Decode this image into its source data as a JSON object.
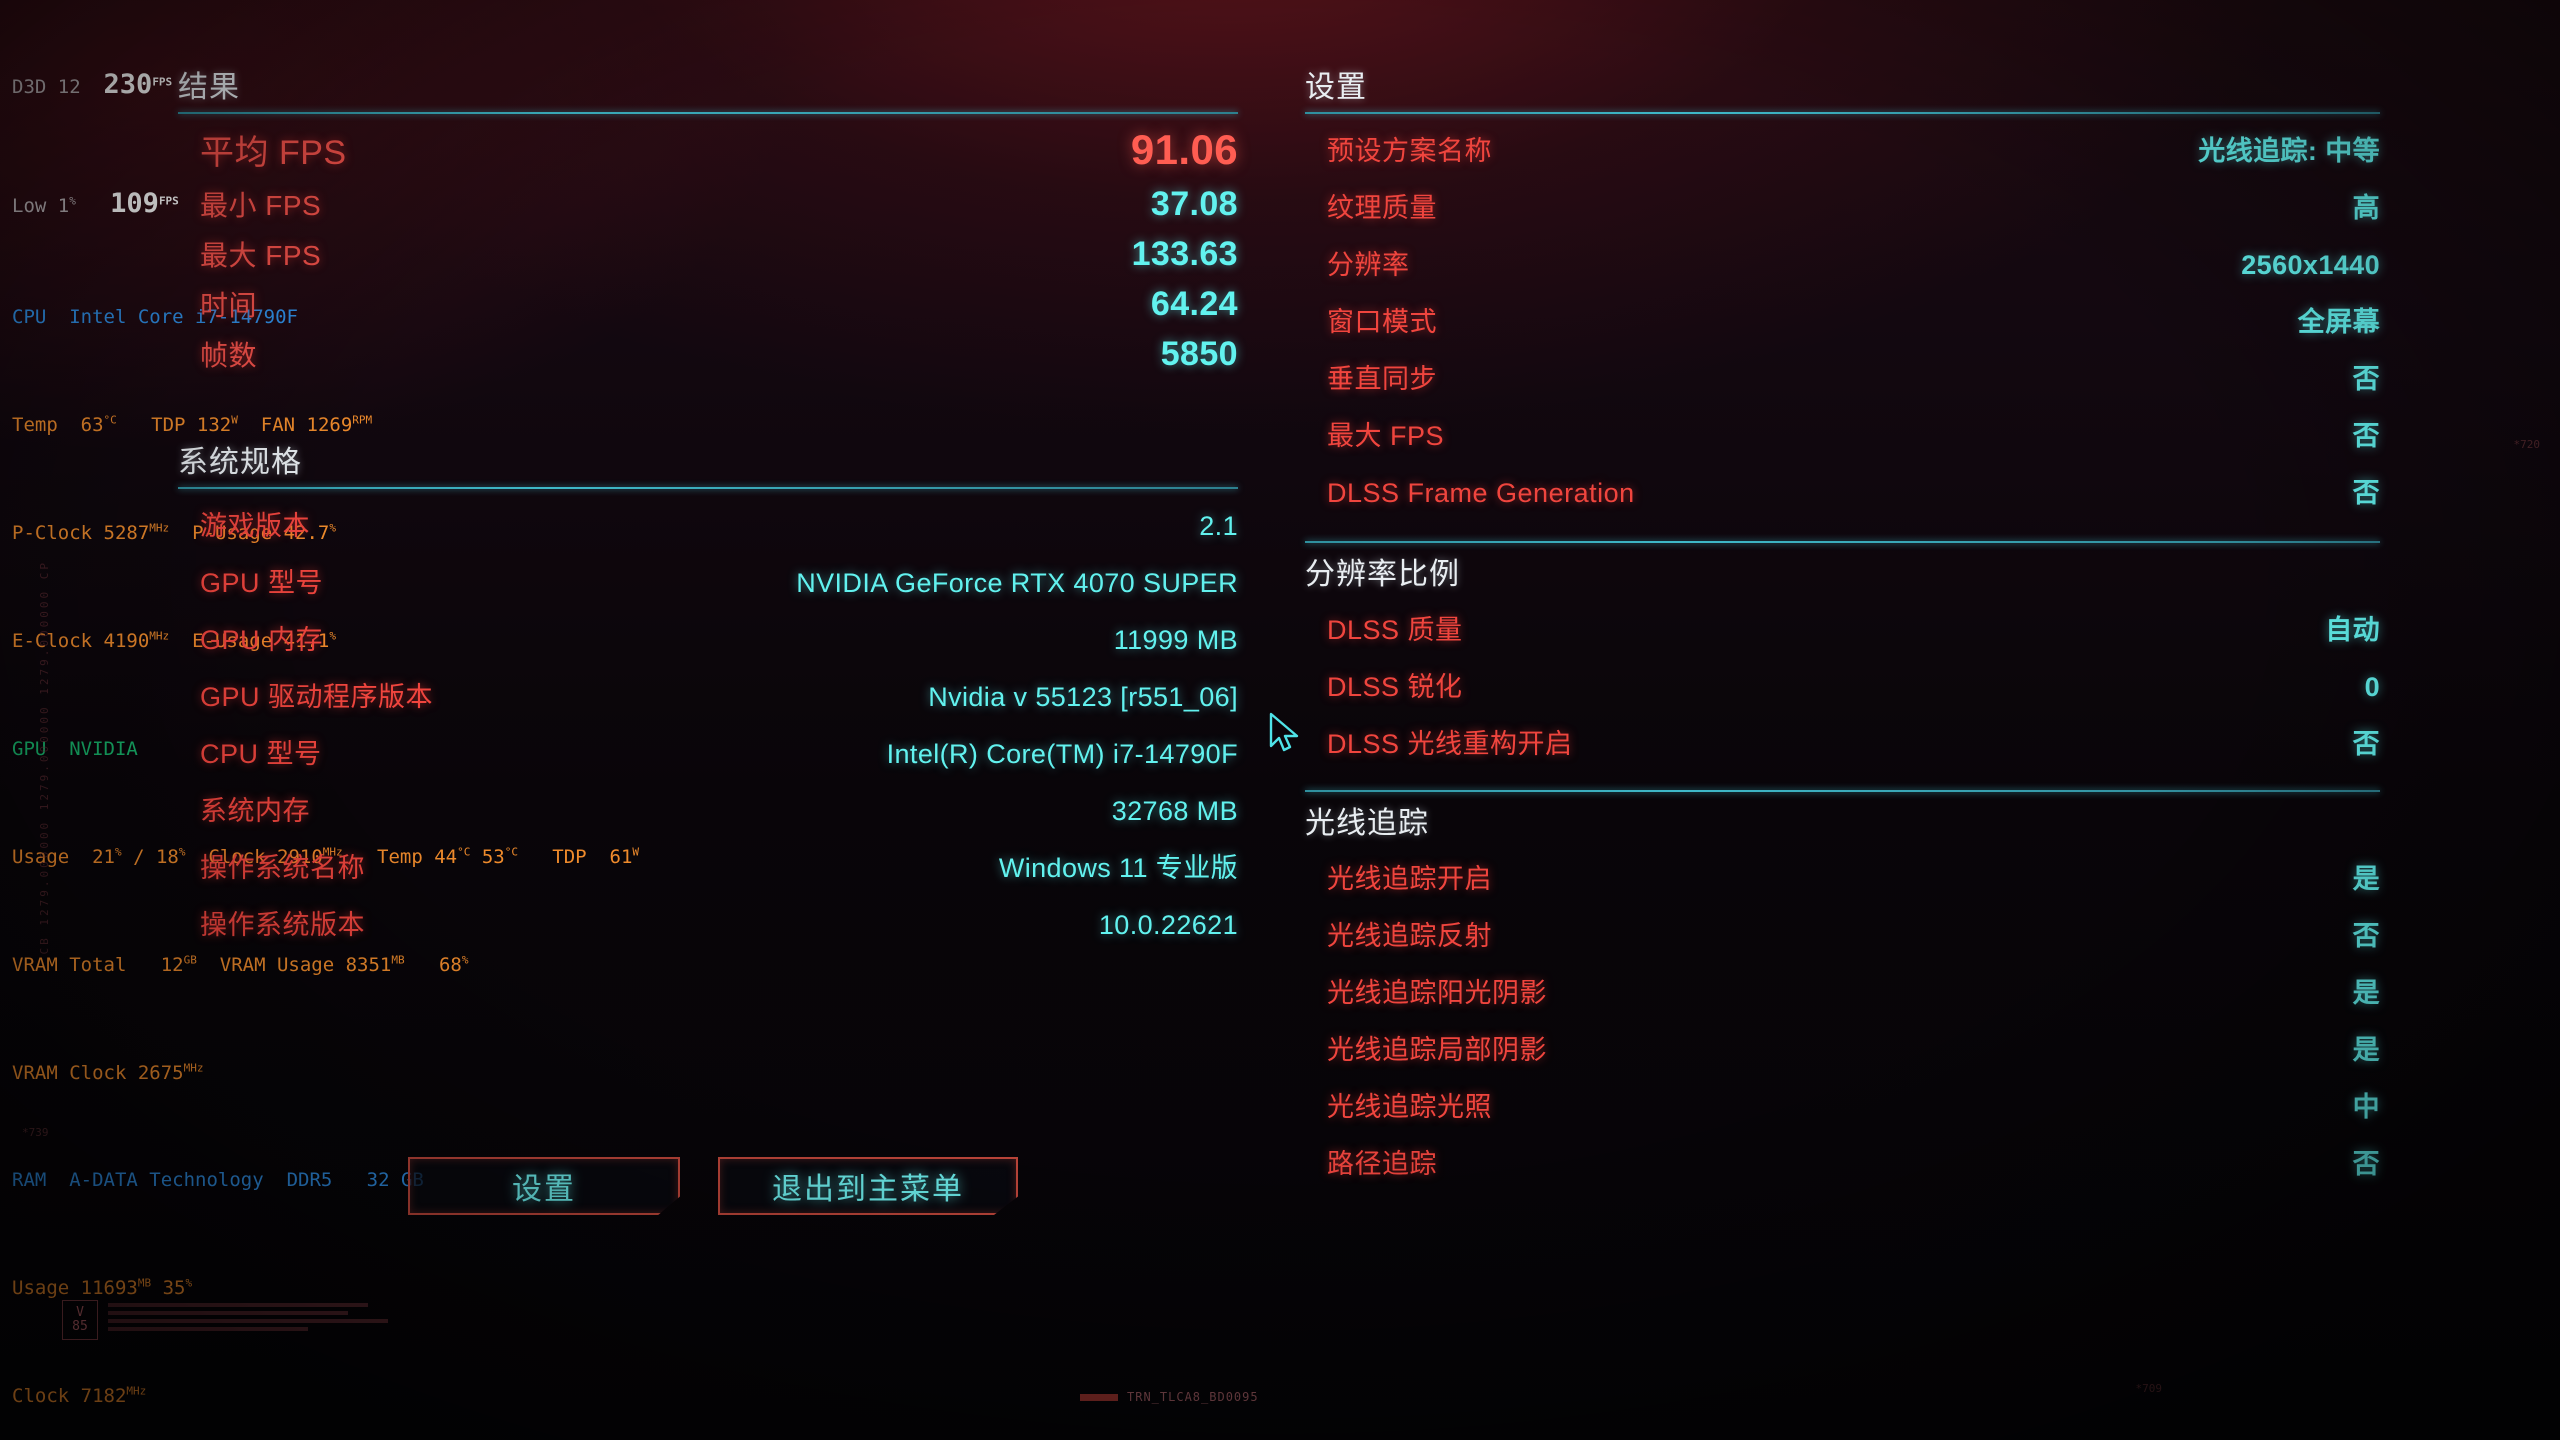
{
  "results": {
    "heading": "结果",
    "rows": [
      {
        "label": "平均 FPS",
        "value": "91.06",
        "primary": true
      },
      {
        "label": "最小 FPS",
        "value": "37.08",
        "primary": false
      },
      {
        "label": "最大 FPS",
        "value": "133.63",
        "primary": false
      },
      {
        "label": "时间",
        "value": "64.24",
        "primary": false
      },
      {
        "label": "帧数",
        "value": "5850",
        "primary": false
      }
    ]
  },
  "specs": {
    "heading": "系统规格",
    "rows": [
      {
        "label": "游戏版本",
        "value": "2.1"
      },
      {
        "label": "GPU 型号",
        "value": "NVIDIA GeForce RTX 4070 SUPER"
      },
      {
        "label": "GPU 内存",
        "value": "11999 MB"
      },
      {
        "label": "GPU 驱动程序版本",
        "value": "Nvidia v 55123 [r551_06]"
      },
      {
        "label": "CPU 型号",
        "value": "Intel(R) Core(TM) i7-14790F"
      },
      {
        "label": "系统内存",
        "value": "32768 MB"
      },
      {
        "label": "操作系统名称",
        "value": "Windows 11 专业版"
      },
      {
        "label": "操作系统版本",
        "value": "10.0.22621"
      }
    ]
  },
  "settings": {
    "heading": "设置",
    "rows": [
      {
        "label": "预设方案名称",
        "value": "光线追踪: 中等"
      },
      {
        "label": "纹理质量",
        "value": "高"
      },
      {
        "label": "分辨率",
        "value": "2560x1440"
      },
      {
        "label": "窗口模式",
        "value": "全屏幕"
      },
      {
        "label": "垂直同步",
        "value": "否"
      },
      {
        "label": "最大 FPS",
        "value": "否"
      },
      {
        "label": "DLSS Frame Generation",
        "value": "否"
      }
    ]
  },
  "resolution_scaling": {
    "heading": "分辨率比例",
    "rows": [
      {
        "label": "DLSS 质量",
        "value": "自动"
      },
      {
        "label": "DLSS 锐化",
        "value": "0"
      },
      {
        "label": "DLSS 光线重构开启",
        "value": "否"
      }
    ]
  },
  "ray_tracing": {
    "heading": "光线追踪",
    "rows": [
      {
        "label": "光线追踪开启",
        "value": "是"
      },
      {
        "label": "光线追踪反射",
        "value": "否"
      },
      {
        "label": "光线追踪阳光阴影",
        "value": "是"
      },
      {
        "label": "光线追踪局部阴影",
        "value": "是"
      },
      {
        "label": "光线追踪光照",
        "value": "中"
      },
      {
        "label": "路径追踪",
        "value": "否"
      }
    ]
  },
  "buttons": {
    "settings": "设置",
    "exit_to_main_menu": "退出到主菜单"
  },
  "osd": {
    "api_label": "D3D 12",
    "fps_value": "230",
    "fps_unit": "FPS",
    "low1_label": "Low 1",
    "low1_percent": "%",
    "low1_value": "109",
    "low1_unit": "FPS",
    "cpu_label": "CPU",
    "cpu_name": "Intel Core i7-14790F",
    "cpu_temp_label": "Temp",
    "cpu_temp": "63",
    "cpu_temp_unit": "°C",
    "cpu_tdp_label": "TDP",
    "cpu_tdp": "132",
    "cpu_tdp_unit": "W",
    "cpu_fan_label": "FAN",
    "cpu_fan": "1269",
    "cpu_fan_unit": "RPM",
    "pclock_label": "P-Clock",
    "pclock": "5287",
    "pclock_unit": "MHz",
    "pusage_label": "P-Usage",
    "pusage": "42.7",
    "pusage_unit": "%",
    "eclock_label": "E-Clock",
    "eclock": "4190",
    "eclock_unit": "MHz",
    "eusage_label": "E-Usage",
    "eusage": "41.1",
    "eusage_unit": "%",
    "gpu_label": "GPU",
    "gpu_vendor": "NVIDIA",
    "gpu_usage_label": "Usage",
    "gpu_usage_1": "21",
    "gpu_usage_sep": "/",
    "gpu_usage_2": "18",
    "gpu_usage_unit": "%",
    "gpu_clock_label": "Clock",
    "gpu_clock": "2910",
    "gpu_clock_unit": "MHz",
    "gpu_temp_label": "Temp",
    "gpu_temp_1": "44",
    "gpu_temp_2": "53",
    "gpu_temp_unit": "°C",
    "gpu_tdp_label": "TDP",
    "gpu_tdp": "61",
    "gpu_tdp_unit": "W",
    "vram_total_label": "VRAM Total",
    "vram_total": "12",
    "vram_total_unit": "GB",
    "vram_usage_label": "VRAM Usage",
    "vram_usage": "8351",
    "vram_usage_unit": "MB",
    "vram_usage_pct": "68",
    "vram_usage_pct_unit": "%",
    "vram_clock_label": "VRAM Clock",
    "vram_clock": "2675",
    "vram_clock_unit": "MHz",
    "ram_label": "RAM",
    "ram_vendor": "A-DATA Technology",
    "ram_type": "DDR5",
    "ram_size": "32 GB",
    "ram_usage_label": "Usage",
    "ram_usage": "11693",
    "ram_usage_unit": "MB",
    "ram_usage_pct": "35",
    "ram_usage_pct_unit": "%",
    "ram_clock_label": "Clock",
    "ram_clock": "7182",
    "ram_clock_unit": "MHz"
  },
  "watermarks": {
    "left_vertical": "CB 1279.000000 1279.000000 1279.000000 CP",
    "right_small": "*720",
    "mid_small": "*739",
    "bottom_right_small": "*709",
    "code_text": "TRN_TLCA8_BD0095",
    "badge_top": "V",
    "badge_bottom": "85"
  },
  "colors": {
    "key_red": "#f0453e",
    "value_cyan": "#62f2ef",
    "heading_white": "#e9eef2",
    "rule_teal": "#3fb9c9",
    "button_border": "#c4483c",
    "primary_value": "#ff5d52"
  }
}
